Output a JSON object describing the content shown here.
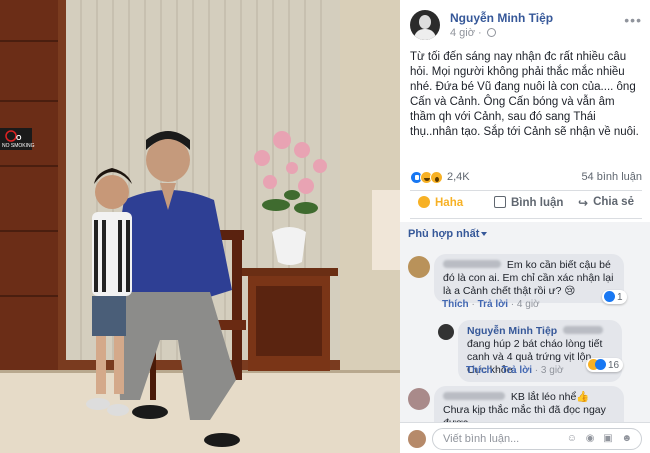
{
  "photo": {
    "sign_text": "NO SMOKING"
  },
  "post": {
    "author": "Nguyễn Minh Tiệp",
    "time": "4 giờ",
    "more_icon": "more-horizontal-icon",
    "text": "Từ tối đến sáng nay nhận đc rất nhiều câu hỏi. Mọi người không phải thắc mắc nhiều nhé. Đứa bé Vũ đang nuôi là con của.... ông Cấn và Cảnh. Ông Cấn bóng và vẫn âm thầm qh với Cảnh, sau đó sang Thái thụ..nhân tạo. Sắp tới Cảnh sẽ nhận về nuôi.",
    "reactions_count": "2,4K",
    "comments_count": "54 bình luận"
  },
  "actions": {
    "haha": "Haha",
    "comment": "Bình luận",
    "share": "Chia sẻ"
  },
  "comments": {
    "sort_label": "Phù hợp nhất",
    "items": [
      {
        "text": "Em ko cần biết cậu bé đó là con ai. Em chỉ cần xác nhận lại là a Cảnh chết thật rồi ư? 😢",
        "like": "Thích",
        "reply": "Trả lời",
        "time": "4 giờ",
        "reactions": "1"
      },
      {
        "author": "Nguyễn Minh Tiệp",
        "text": "đang húp 2 bát cháo lòng tiết canh và 4 quả trứng vịt lộn. Cực khỏe.",
        "like": "Thích",
        "reply": "Trả lời",
        "time": "3 giờ",
        "reactions": "16"
      },
      {
        "text_a": "KB lắt léo nhể👍",
        "text_b": "Chưa kịp thắc mắc thì đã đọc ngay được"
      }
    ]
  },
  "composer": {
    "placeholder": "Viết bình luận...",
    "icons": "☺ ◉ ▣ ☻"
  }
}
